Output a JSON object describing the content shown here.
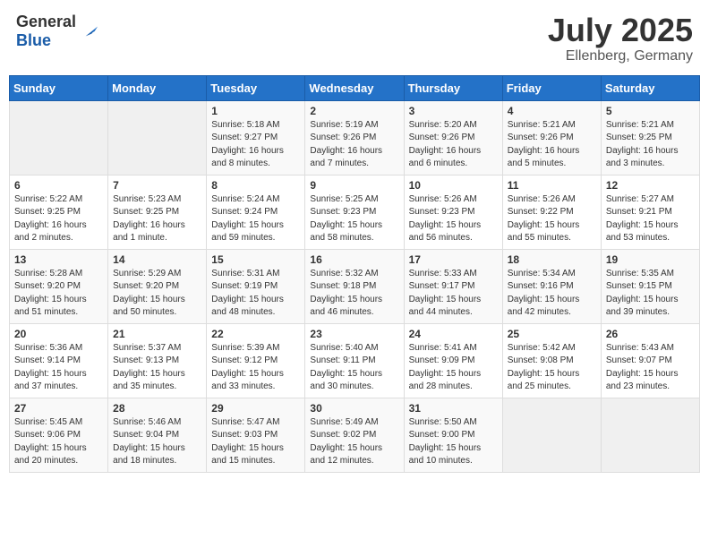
{
  "header": {
    "logo_general": "General",
    "logo_blue": "Blue",
    "title": "July 2025",
    "location": "Ellenberg, Germany"
  },
  "weekdays": [
    "Sunday",
    "Monday",
    "Tuesday",
    "Wednesday",
    "Thursday",
    "Friday",
    "Saturday"
  ],
  "weeks": [
    [
      {
        "day": "",
        "info": ""
      },
      {
        "day": "",
        "info": ""
      },
      {
        "day": "1",
        "info": "Sunrise: 5:18 AM\nSunset: 9:27 PM\nDaylight: 16 hours and 8 minutes."
      },
      {
        "day": "2",
        "info": "Sunrise: 5:19 AM\nSunset: 9:26 PM\nDaylight: 16 hours and 7 minutes."
      },
      {
        "day": "3",
        "info": "Sunrise: 5:20 AM\nSunset: 9:26 PM\nDaylight: 16 hours and 6 minutes."
      },
      {
        "day": "4",
        "info": "Sunrise: 5:21 AM\nSunset: 9:26 PM\nDaylight: 16 hours and 5 minutes."
      },
      {
        "day": "5",
        "info": "Sunrise: 5:21 AM\nSunset: 9:25 PM\nDaylight: 16 hours and 3 minutes."
      }
    ],
    [
      {
        "day": "6",
        "info": "Sunrise: 5:22 AM\nSunset: 9:25 PM\nDaylight: 16 hours and 2 minutes."
      },
      {
        "day": "7",
        "info": "Sunrise: 5:23 AM\nSunset: 9:25 PM\nDaylight: 16 hours and 1 minute."
      },
      {
        "day": "8",
        "info": "Sunrise: 5:24 AM\nSunset: 9:24 PM\nDaylight: 15 hours and 59 minutes."
      },
      {
        "day": "9",
        "info": "Sunrise: 5:25 AM\nSunset: 9:23 PM\nDaylight: 15 hours and 58 minutes."
      },
      {
        "day": "10",
        "info": "Sunrise: 5:26 AM\nSunset: 9:23 PM\nDaylight: 15 hours and 56 minutes."
      },
      {
        "day": "11",
        "info": "Sunrise: 5:26 AM\nSunset: 9:22 PM\nDaylight: 15 hours and 55 minutes."
      },
      {
        "day": "12",
        "info": "Sunrise: 5:27 AM\nSunset: 9:21 PM\nDaylight: 15 hours and 53 minutes."
      }
    ],
    [
      {
        "day": "13",
        "info": "Sunrise: 5:28 AM\nSunset: 9:20 PM\nDaylight: 15 hours and 51 minutes."
      },
      {
        "day": "14",
        "info": "Sunrise: 5:29 AM\nSunset: 9:20 PM\nDaylight: 15 hours and 50 minutes."
      },
      {
        "day": "15",
        "info": "Sunrise: 5:31 AM\nSunset: 9:19 PM\nDaylight: 15 hours and 48 minutes."
      },
      {
        "day": "16",
        "info": "Sunrise: 5:32 AM\nSunset: 9:18 PM\nDaylight: 15 hours and 46 minutes."
      },
      {
        "day": "17",
        "info": "Sunrise: 5:33 AM\nSunset: 9:17 PM\nDaylight: 15 hours and 44 minutes."
      },
      {
        "day": "18",
        "info": "Sunrise: 5:34 AM\nSunset: 9:16 PM\nDaylight: 15 hours and 42 minutes."
      },
      {
        "day": "19",
        "info": "Sunrise: 5:35 AM\nSunset: 9:15 PM\nDaylight: 15 hours and 39 minutes."
      }
    ],
    [
      {
        "day": "20",
        "info": "Sunrise: 5:36 AM\nSunset: 9:14 PM\nDaylight: 15 hours and 37 minutes."
      },
      {
        "day": "21",
        "info": "Sunrise: 5:37 AM\nSunset: 9:13 PM\nDaylight: 15 hours and 35 minutes."
      },
      {
        "day": "22",
        "info": "Sunrise: 5:39 AM\nSunset: 9:12 PM\nDaylight: 15 hours and 33 minutes."
      },
      {
        "day": "23",
        "info": "Sunrise: 5:40 AM\nSunset: 9:11 PM\nDaylight: 15 hours and 30 minutes."
      },
      {
        "day": "24",
        "info": "Sunrise: 5:41 AM\nSunset: 9:09 PM\nDaylight: 15 hours and 28 minutes."
      },
      {
        "day": "25",
        "info": "Sunrise: 5:42 AM\nSunset: 9:08 PM\nDaylight: 15 hours and 25 minutes."
      },
      {
        "day": "26",
        "info": "Sunrise: 5:43 AM\nSunset: 9:07 PM\nDaylight: 15 hours and 23 minutes."
      }
    ],
    [
      {
        "day": "27",
        "info": "Sunrise: 5:45 AM\nSunset: 9:06 PM\nDaylight: 15 hours and 20 minutes."
      },
      {
        "day": "28",
        "info": "Sunrise: 5:46 AM\nSunset: 9:04 PM\nDaylight: 15 hours and 18 minutes."
      },
      {
        "day": "29",
        "info": "Sunrise: 5:47 AM\nSunset: 9:03 PM\nDaylight: 15 hours and 15 minutes."
      },
      {
        "day": "30",
        "info": "Sunrise: 5:49 AM\nSunset: 9:02 PM\nDaylight: 15 hours and 12 minutes."
      },
      {
        "day": "31",
        "info": "Sunrise: 5:50 AM\nSunset: 9:00 PM\nDaylight: 15 hours and 10 minutes."
      },
      {
        "day": "",
        "info": ""
      },
      {
        "day": "",
        "info": ""
      }
    ]
  ]
}
